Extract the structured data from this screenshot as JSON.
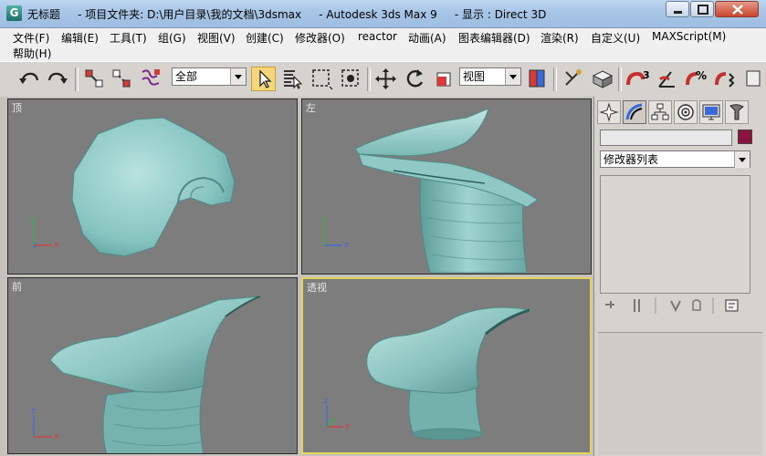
{
  "window": {
    "title": "无标题     - 项目文件夹: D:\\用户目录\\我的文档\\3dsmax     - Autodesk 3ds Max 9     - 显示 : Direct 3D",
    "app_icon_glyph": "G"
  },
  "menu": [
    "文件(F)",
    "编辑(E)",
    "工具(T)",
    "组(G)",
    "视图(V)",
    "创建(C)",
    "修改器(O)",
    "reactor",
    "动画(A)",
    "图表编辑器(D)",
    "渲染(R)",
    "自定义(U)",
    "MAXScript(M)",
    "帮助(H)"
  ],
  "toolbar": {
    "selection_filter": "全部",
    "reference_coord": "视图",
    "snap_label": "3",
    "percent_snap_label": "%",
    "buttons": [
      "undo-icon",
      "redo-icon",
      "select-and-link-icon",
      "unlink-icon",
      "bind-space-warp-icon",
      "select-object-icon",
      "select-by-name-icon",
      "rectangular-selection-icon",
      "window-crossing-icon",
      "move-icon",
      "rotate-icon",
      "scale-icon",
      "use-pivot-icon",
      "select-and-manipulate-icon",
      "keyboard-shortcut-icon",
      "snaps-toggle-icon",
      "angle-snap-icon",
      "percent-snap-icon",
      "spinner-snap-icon"
    ]
  },
  "viewports": {
    "top": "顶",
    "left": "左",
    "front": "前",
    "perspective": "透视"
  },
  "axes": {
    "x": "x",
    "y": "y",
    "z": "z"
  },
  "command_panel": {
    "modifier_list": "修改器列表",
    "object_color": "#8a1340",
    "tabs": [
      "create-tab-icon",
      "modify-tab-icon",
      "hierarchy-tab-icon",
      "motion-tab-icon",
      "display-tab-icon",
      "utilities-tab-icon"
    ]
  },
  "colors": {
    "viewport_bg": "#7d7d7d",
    "active_border": "#e8d35a",
    "mesh": "#8ec7c3"
  }
}
